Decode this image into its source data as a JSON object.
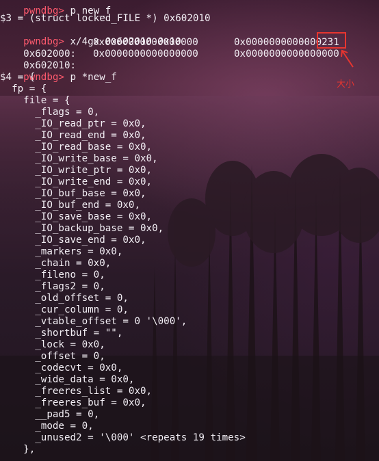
{
  "top_prompt_partial": "pwndbg> p new_f",
  "lines": [
    {
      "indent": "",
      "text": "$3 = (struct locked_FILE *) 0x602010"
    },
    {
      "prompt": "pwndbg>",
      "cmd": " x/4gx 0x602010-0x10"
    },
    {
      "addr": "0x602000:",
      "col1": "0x0000000000000000",
      "col2": "0x0000000000000231"
    },
    {
      "addr": "0x602010:",
      "col1": "0x0000000000000000",
      "col2": "0x0000000000000000"
    },
    {
      "prompt": "pwndbg>",
      "cmd": " p *new_f"
    },
    {
      "text": "$4 = {"
    },
    {
      "text": "  fp = {"
    },
    {
      "text": "    file = {"
    },
    {
      "text": "      _flags = 0,"
    },
    {
      "text": "      _IO_read_ptr = 0x0,"
    },
    {
      "text": "      _IO_read_end = 0x0,"
    },
    {
      "text": "      _IO_read_base = 0x0,"
    },
    {
      "text": "      _IO_write_base = 0x0,"
    },
    {
      "text": "      _IO_write_ptr = 0x0,"
    },
    {
      "text": "      _IO_write_end = 0x0,"
    },
    {
      "text": "      _IO_buf_base = 0x0,"
    },
    {
      "text": "      _IO_buf_end = 0x0,"
    },
    {
      "text": "      _IO_save_base = 0x0,"
    },
    {
      "text": "      _IO_backup_base = 0x0,"
    },
    {
      "text": "      _IO_save_end = 0x0,"
    },
    {
      "text": "      _markers = 0x0,"
    },
    {
      "text": "      _chain = 0x0,"
    },
    {
      "text": "      _fileno = 0,"
    },
    {
      "text": "      _flags2 = 0,"
    },
    {
      "text": "      _old_offset = 0,"
    },
    {
      "text": "      _cur_column = 0,"
    },
    {
      "text": "      _vtable_offset = 0 '\\000',"
    },
    {
      "text": "      _shortbuf = \"\","
    },
    {
      "text": "      _lock = 0x0,"
    },
    {
      "text": "      _offset = 0,"
    },
    {
      "text": "      _codecvt = 0x0,"
    },
    {
      "text": "      _wide_data = 0x0,"
    },
    {
      "text": "      _freeres_list = 0x0,"
    },
    {
      "text": "      _freeres_buf = 0x0,"
    },
    {
      "text": "      __pad5 = 0,"
    },
    {
      "text": "      _mode = 0,"
    },
    {
      "text": "      _unused2 = '\\000' <repeats 19 times>"
    },
    {
      "text": "    },"
    }
  ],
  "annotation": {
    "label": "大小",
    "color": "#e8352f"
  },
  "colors": {
    "prompt": "#ff5a6e",
    "text": "#f2eef4",
    "annotation": "#e8352f"
  }
}
